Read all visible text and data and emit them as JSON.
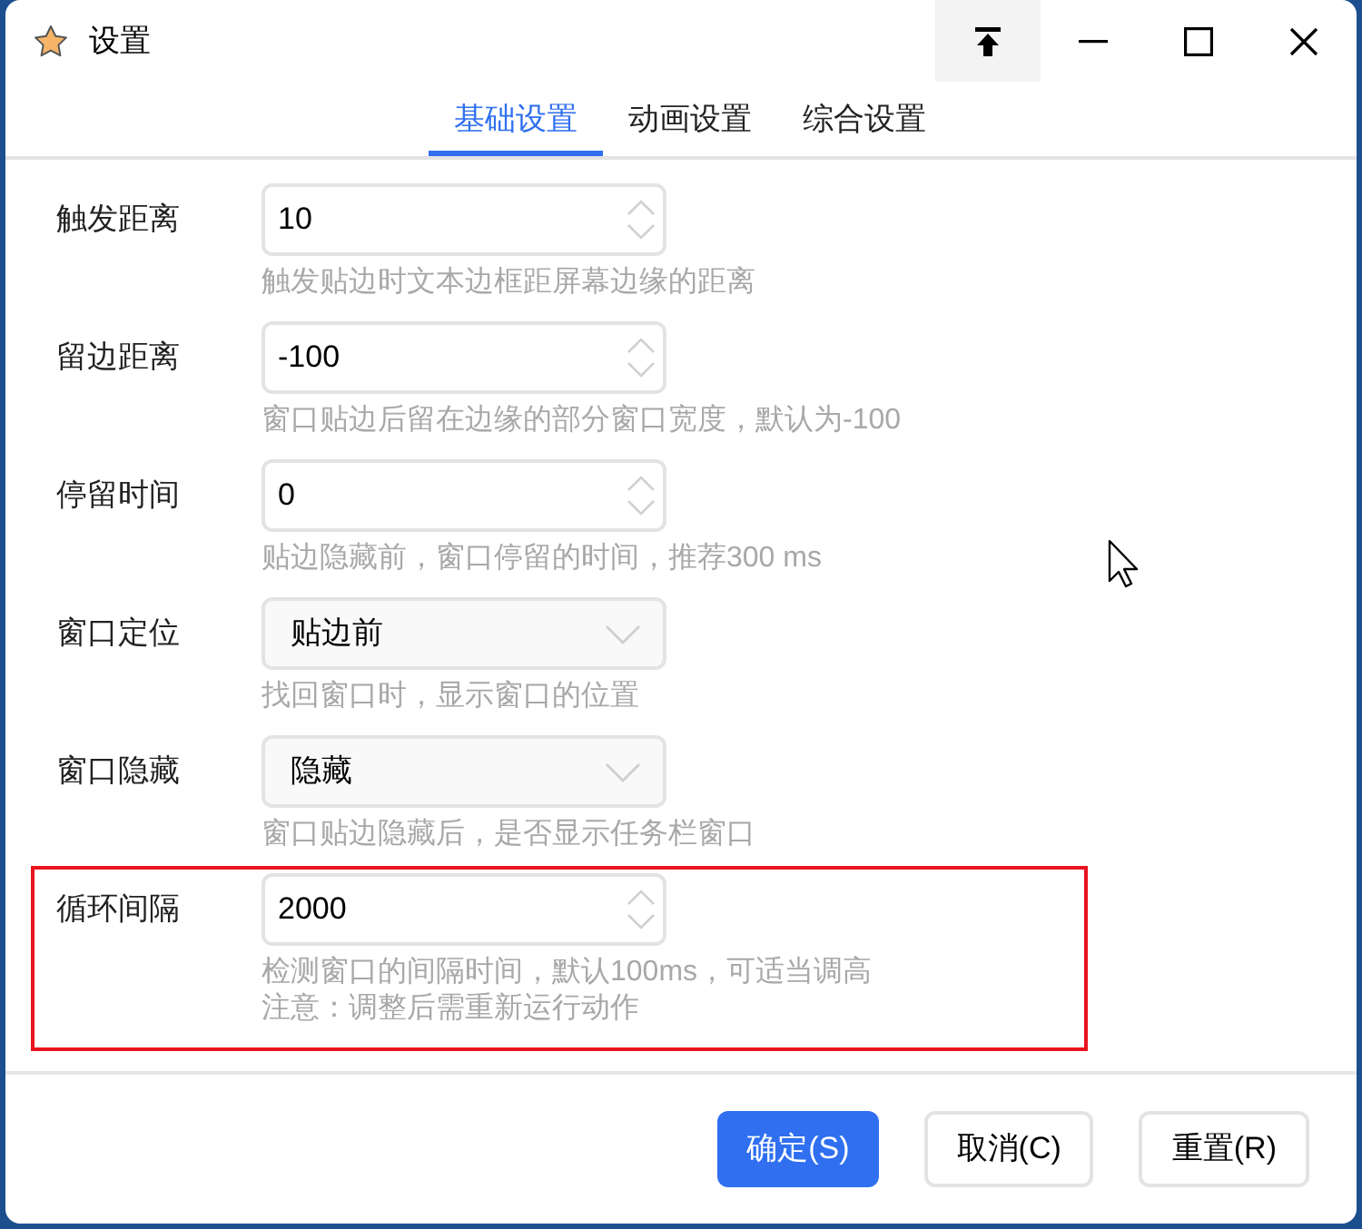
{
  "window": {
    "title": "设置"
  },
  "tabs": [
    {
      "label": "基础设置",
      "selected": true
    },
    {
      "label": "动画设置",
      "selected": false
    },
    {
      "label": "综合设置",
      "selected": false
    }
  ],
  "settings": [
    {
      "label": "触发距离",
      "kind": "number",
      "value": "10",
      "hints": [
        "触发贴边时文本边框距屏幕边缘的距离"
      ],
      "highlighted": false
    },
    {
      "label": "留边距离",
      "kind": "number",
      "value": "-100",
      "hints": [
        "窗口贴边后留在边缘的部分窗口宽度，默认为-100"
      ],
      "highlighted": false
    },
    {
      "label": "停留时间",
      "kind": "number",
      "value": "0",
      "hints": [
        "贴边隐藏前，窗口停留的时间，推荐300 ms"
      ],
      "highlighted": false
    },
    {
      "label": "窗口定位",
      "kind": "select",
      "value": "贴边前",
      "hints": [
        "找回窗口时，显示窗口的位置"
      ],
      "highlighted": false
    },
    {
      "label": "窗口隐藏",
      "kind": "select",
      "value": "隐藏",
      "hints": [
        "窗口贴边隐藏后，是否显示任务栏窗口"
      ],
      "highlighted": false
    },
    {
      "label": "循环间隔",
      "kind": "number",
      "value": "2000",
      "hints": [
        "检测窗口的间隔时间，默认100ms，可适当调高",
        "注意：调整后需重新运行动作"
      ],
      "highlighted": true
    }
  ],
  "buttons": [
    {
      "label": "确定(S)",
      "kind": "primary"
    },
    {
      "label": "取消(C)",
      "kind": "default"
    },
    {
      "label": "重置(R)",
      "kind": "default"
    }
  ]
}
